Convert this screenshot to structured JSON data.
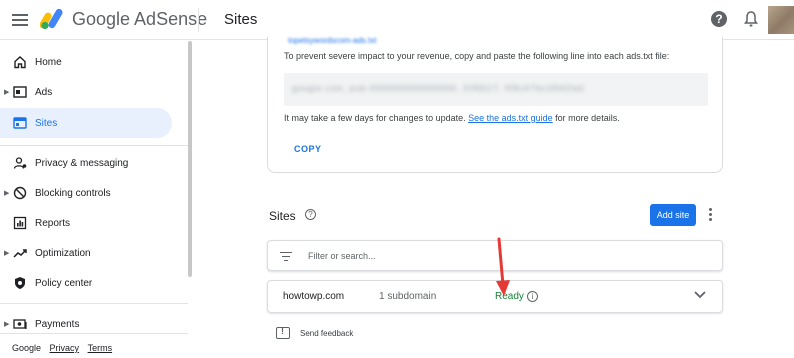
{
  "header": {
    "brand": "Google AdSense",
    "page_title": "Sites",
    "help_glyph": "?"
  },
  "sidebar": {
    "items": [
      {
        "label": "Home",
        "icon": "home-icon",
        "expandable": false
      },
      {
        "label": "Ads",
        "icon": "ads-icon",
        "expandable": true
      },
      {
        "label": "Sites",
        "icon": "sites-icon",
        "expandable": false,
        "active": true
      },
      {
        "label": "Privacy & messaging",
        "icon": "privacy-icon",
        "expandable": false
      },
      {
        "label": "Blocking controls",
        "icon": "blocking-icon",
        "expandable": true
      },
      {
        "label": "Reports",
        "icon": "reports-icon",
        "expandable": false
      },
      {
        "label": "Optimization",
        "icon": "optimization-icon",
        "expandable": true
      },
      {
        "label": "Policy center",
        "icon": "policy-icon",
        "expandable": false
      },
      {
        "label": "Payments",
        "icon": "payments-icon",
        "expandable": true
      }
    ],
    "footer": {
      "google": "Google",
      "privacy": "Privacy",
      "terms": "Terms"
    }
  },
  "ads_txt_card": {
    "clipped_link": "topetsywordscom-ads.txt",
    "instruction": "To prevent severe impact to your revenue, copy and paste the following line into each ads.txt file:",
    "code_line": "google.com, pub-0000000000000000, DIRECT, f08c47fec0942fa0",
    "note_before": "It may take a few days for changes to update. ",
    "guide_link": "See the ads.txt guide",
    "note_after": " for more details.",
    "copy_label": "COPY"
  },
  "sites_section": {
    "title": "Sites",
    "help_glyph": "?",
    "add_site_label": "Add site",
    "filter_placeholder": "Filter or search...",
    "rows": [
      {
        "domain": "howtowp.com",
        "subdomains": "1 subdomain",
        "status": "Ready",
        "info_glyph": "i"
      }
    ],
    "send_feedback": "Send feedback"
  },
  "colors": {
    "accent": "#1a73e8",
    "ready": "#188038",
    "annotation_arrow": "#e53935",
    "active_nav_bg": "#e8f0fe"
  }
}
